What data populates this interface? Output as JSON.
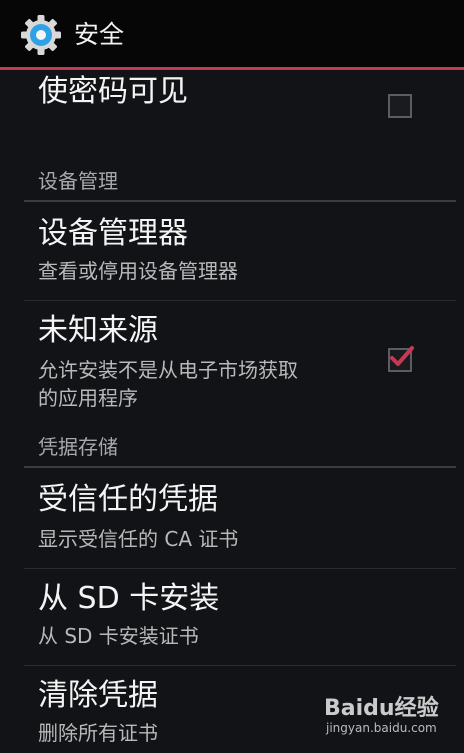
{
  "action_bar": {
    "title": "安全",
    "icon": "gear-icon"
  },
  "items": {
    "show_password": {
      "title": "使密码可见",
      "checked": false
    },
    "device_admin_header": "设备管理",
    "device_admin": {
      "title": "设备管理器",
      "summary": "查看或停用设备管理器"
    },
    "unknown_sources": {
      "title": "未知来源",
      "summary_line1": "允许安装不是从电子市场获取",
      "summary_line2": "的应用程序",
      "checked": true
    },
    "credential_storage_header": "凭据存储",
    "trusted_credentials": {
      "title": "受信任的凭据",
      "summary": "显示受信任的 CA 证书"
    },
    "install_from_sd": {
      "title": "从 SD 卡安装",
      "summary": "从 SD 卡安装证书"
    },
    "clear_credentials": {
      "title": "清除凭据",
      "summary": "删除所有证书"
    }
  },
  "watermark": {
    "brand": "Baidu经验",
    "url": "jingyan.baidu.com"
  },
  "colors": {
    "accent": "#c43a55",
    "background": "#121316",
    "icon_blue": "#2fa2e6"
  }
}
